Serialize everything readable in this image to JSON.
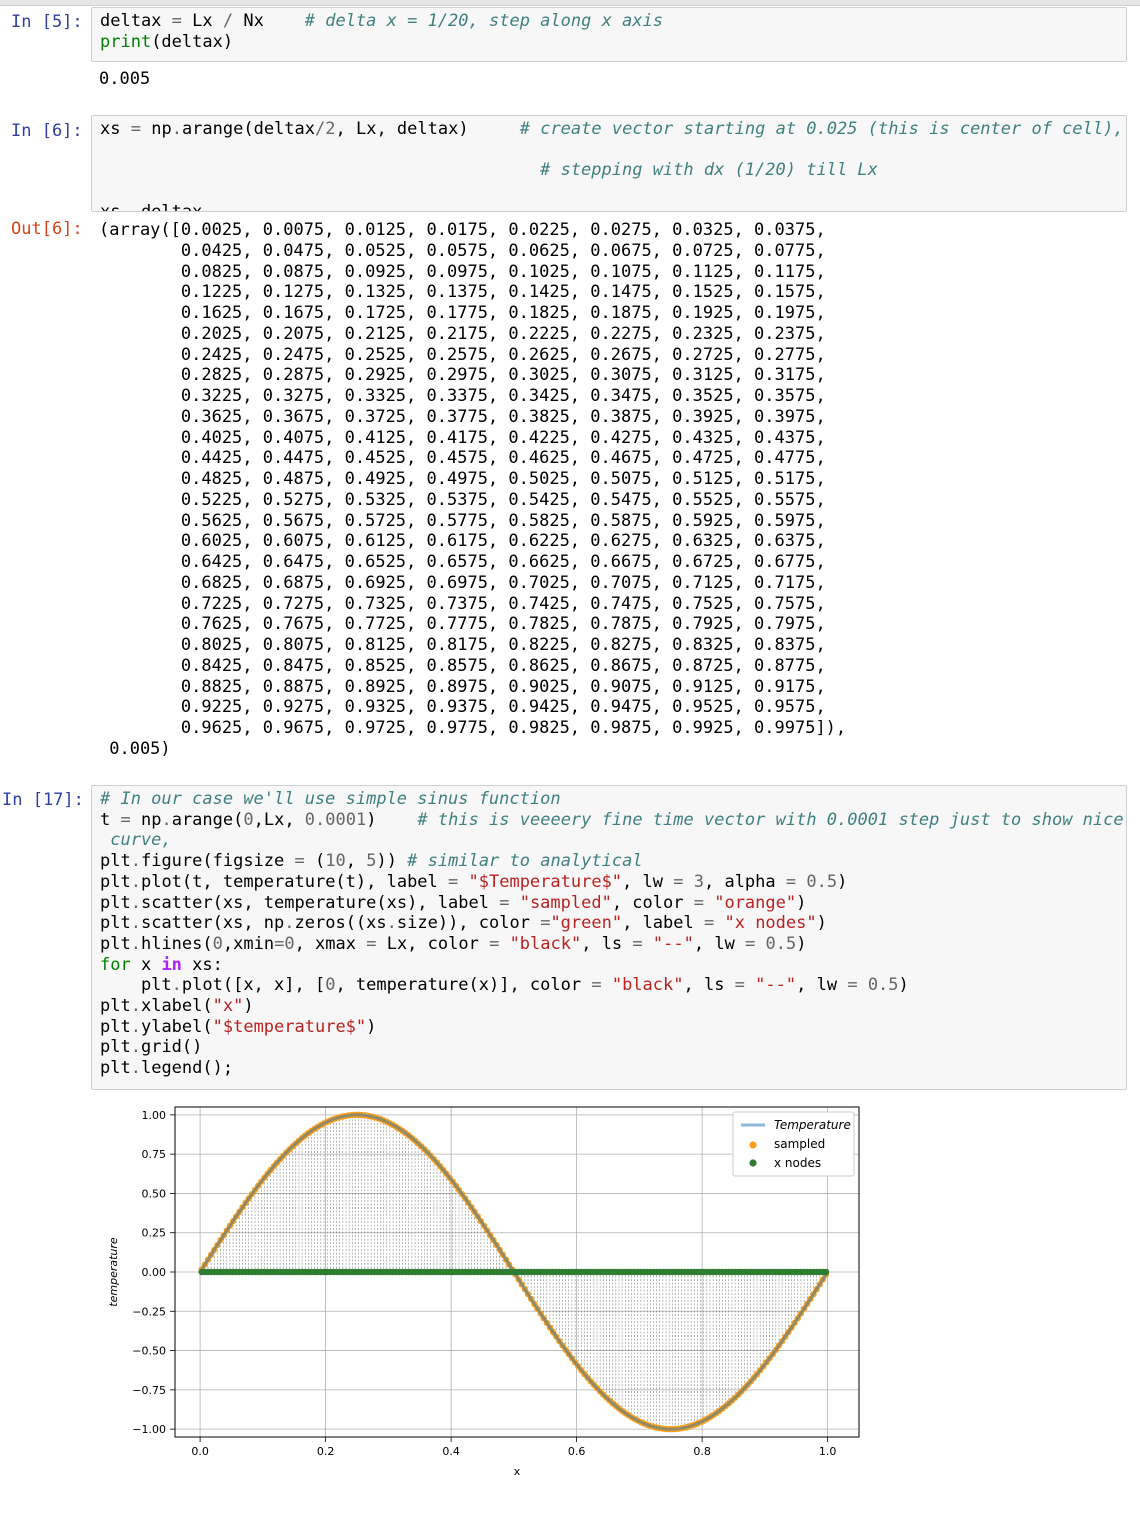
{
  "cells": [
    {
      "prompt": "In [5]:",
      "lines": [
        [
          {
            "t": "deltax "
          },
          {
            "t": "=",
            "c": "op"
          },
          {
            "t": " Lx "
          },
          {
            "t": "/",
            "c": "op"
          },
          {
            "t": " Nx    "
          },
          {
            "t": "# delta x = 1/20, step along x axis",
            "c": "cm"
          }
        ],
        [
          {
            "t": "print",
            "c": "kw"
          },
          {
            "t": "(deltax)"
          }
        ]
      ],
      "output": "0.005"
    },
    {
      "prompt": "In [6]:",
      "lines": [
        [
          {
            "t": "xs "
          },
          {
            "t": "=",
            "c": "op"
          },
          {
            "t": " np"
          },
          {
            "t": ".",
            "c": "op"
          },
          {
            "t": "arange(deltax"
          },
          {
            "t": "/",
            "c": "op"
          },
          {
            "t": "2",
            "c": "nm"
          },
          {
            "t": ", Lx, deltax)     "
          },
          {
            "t": "# create vector starting at 0.025 (this is center of cell),",
            "c": "cm"
          }
        ],
        [
          {
            "t": ""
          }
        ],
        [
          {
            "t": "                                           "
          },
          {
            "t": "# stepping with dx (1/20) till Lx",
            "c": "cm"
          }
        ],
        [
          {
            "t": ""
          }
        ],
        [
          {
            "t": "xs, deltax"
          }
        ]
      ],
      "out_prompt": "Out[6]:",
      "output": "(array([0.0025, 0.0075, 0.0125, 0.0175, 0.0225, 0.0275, 0.0325, 0.0375,\n        0.0425, 0.0475, 0.0525, 0.0575, 0.0625, 0.0675, 0.0725, 0.0775,\n        0.0825, 0.0875, 0.0925, 0.0975, 0.1025, 0.1075, 0.1125, 0.1175,\n        0.1225, 0.1275, 0.1325, 0.1375, 0.1425, 0.1475, 0.1525, 0.1575,\n        0.1625, 0.1675, 0.1725, 0.1775, 0.1825, 0.1875, 0.1925, 0.1975,\n        0.2025, 0.2075, 0.2125, 0.2175, 0.2225, 0.2275, 0.2325, 0.2375,\n        0.2425, 0.2475, 0.2525, 0.2575, 0.2625, 0.2675, 0.2725, 0.2775,\n        0.2825, 0.2875, 0.2925, 0.2975, 0.3025, 0.3075, 0.3125, 0.3175,\n        0.3225, 0.3275, 0.3325, 0.3375, 0.3425, 0.3475, 0.3525, 0.3575,\n        0.3625, 0.3675, 0.3725, 0.3775, 0.3825, 0.3875, 0.3925, 0.3975,\n        0.4025, 0.4075, 0.4125, 0.4175, 0.4225, 0.4275, 0.4325, 0.4375,\n        0.4425, 0.4475, 0.4525, 0.4575, 0.4625, 0.4675, 0.4725, 0.4775,\n        0.4825, 0.4875, 0.4925, 0.4975, 0.5025, 0.5075, 0.5125, 0.5175,\n        0.5225, 0.5275, 0.5325, 0.5375, 0.5425, 0.5475, 0.5525, 0.5575,\n        0.5625, 0.5675, 0.5725, 0.5775, 0.5825, 0.5875, 0.5925, 0.5975,\n        0.6025, 0.6075, 0.6125, 0.6175, 0.6225, 0.6275, 0.6325, 0.6375,\n        0.6425, 0.6475, 0.6525, 0.6575, 0.6625, 0.6675, 0.6725, 0.6775,\n        0.6825, 0.6875, 0.6925, 0.6975, 0.7025, 0.7075, 0.7125, 0.7175,\n        0.7225, 0.7275, 0.7325, 0.7375, 0.7425, 0.7475, 0.7525, 0.7575,\n        0.7625, 0.7675, 0.7725, 0.7775, 0.7825, 0.7875, 0.7925, 0.7975,\n        0.8025, 0.8075, 0.8125, 0.8175, 0.8225, 0.8275, 0.8325, 0.8375,\n        0.8425, 0.8475, 0.8525, 0.8575, 0.8625, 0.8675, 0.8725, 0.8775,\n        0.8825, 0.8875, 0.8925, 0.8975, 0.9025, 0.9075, 0.9125, 0.9175,\n        0.9225, 0.9275, 0.9325, 0.9375, 0.9425, 0.9475, 0.9525, 0.9575,\n        0.9625, 0.9675, 0.9725, 0.9775, 0.9825, 0.9875, 0.9925, 0.9975]),\n 0.005)"
    },
    {
      "prompt": "In [17]:",
      "lines": [
        [
          {
            "t": "# In our case we'll use simple sinus function",
            "c": "cm"
          }
        ],
        [
          {
            "t": "t "
          },
          {
            "t": "=",
            "c": "op"
          },
          {
            "t": " np"
          },
          {
            "t": ".",
            "c": "op"
          },
          {
            "t": "arange("
          },
          {
            "t": "0",
            "c": "nm"
          },
          {
            "t": ",Lx, "
          },
          {
            "t": "0.0001",
            "c": "nm"
          },
          {
            "t": ")    "
          },
          {
            "t": "# this is veeeery fine time vector with 0.0001 step just to show nice",
            "c": "cm"
          }
        ],
        [
          {
            "t": " curve,",
            "c": "cm"
          }
        ],
        [
          {
            "t": "plt"
          },
          {
            "t": ".",
            "c": "op"
          },
          {
            "t": "figure(figsize "
          },
          {
            "t": "=",
            "c": "op"
          },
          {
            "t": " ("
          },
          {
            "t": "10",
            "c": "nm"
          },
          {
            "t": ", "
          },
          {
            "t": "5",
            "c": "nm"
          },
          {
            "t": ")) "
          },
          {
            "t": "# similar to analytical",
            "c": "cm"
          }
        ],
        [
          {
            "t": "plt"
          },
          {
            "t": ".",
            "c": "op"
          },
          {
            "t": "plot(t, temperature(t), label "
          },
          {
            "t": "=",
            "c": "op"
          },
          {
            "t": " "
          },
          {
            "t": "\"$Temperature$\"",
            "c": "st"
          },
          {
            "t": ", lw "
          },
          {
            "t": "=",
            "c": "op"
          },
          {
            "t": " "
          },
          {
            "t": "3",
            "c": "nm"
          },
          {
            "t": ", alpha "
          },
          {
            "t": "=",
            "c": "op"
          },
          {
            "t": " "
          },
          {
            "t": "0.5",
            "c": "nm"
          },
          {
            "t": ")"
          }
        ],
        [
          {
            "t": "plt"
          },
          {
            "t": ".",
            "c": "op"
          },
          {
            "t": "scatter(xs, temperature(xs), label "
          },
          {
            "t": "=",
            "c": "op"
          },
          {
            "t": " "
          },
          {
            "t": "\"sampled\"",
            "c": "st"
          },
          {
            "t": ", color "
          },
          {
            "t": "=",
            "c": "op"
          },
          {
            "t": " "
          },
          {
            "t": "\"orange\"",
            "c": "st"
          },
          {
            "t": ")"
          }
        ],
        [
          {
            "t": "plt"
          },
          {
            "t": ".",
            "c": "op"
          },
          {
            "t": "scatter(xs, np"
          },
          {
            "t": ".",
            "c": "op"
          },
          {
            "t": "zeros((xs"
          },
          {
            "t": ".",
            "c": "op"
          },
          {
            "t": "size)), color "
          },
          {
            "t": "=",
            "c": "op"
          },
          {
            "t": "\"green\"",
            "c": "st"
          },
          {
            "t": ", label "
          },
          {
            "t": "=",
            "c": "op"
          },
          {
            "t": " "
          },
          {
            "t": "\"x nodes\"",
            "c": "st"
          },
          {
            "t": ")"
          }
        ],
        [
          {
            "t": "plt"
          },
          {
            "t": ".",
            "c": "op"
          },
          {
            "t": "hlines("
          },
          {
            "t": "0",
            "c": "nm"
          },
          {
            "t": ",xmin"
          },
          {
            "t": "=",
            "c": "op"
          },
          {
            "t": "0",
            "c": "nm"
          },
          {
            "t": ", xmax "
          },
          {
            "t": "=",
            "c": "op"
          },
          {
            "t": " Lx, color "
          },
          {
            "t": "=",
            "c": "op"
          },
          {
            "t": " "
          },
          {
            "t": "\"black\"",
            "c": "st"
          },
          {
            "t": ", ls "
          },
          {
            "t": "=",
            "c": "op"
          },
          {
            "t": " "
          },
          {
            "t": "\"--\"",
            "c": "st"
          },
          {
            "t": ", lw "
          },
          {
            "t": "=",
            "c": "op"
          },
          {
            "t": " "
          },
          {
            "t": "0.5",
            "c": "nm"
          },
          {
            "t": ")"
          }
        ],
        [
          {
            "t": "for",
            "c": "kw"
          },
          {
            "t": " x "
          },
          {
            "t": "in",
            "c": "kw2"
          },
          {
            "t": " xs:"
          }
        ],
        [
          {
            "t": "    plt"
          },
          {
            "t": ".",
            "c": "op"
          },
          {
            "t": "plot([x, x], ["
          },
          {
            "t": "0",
            "c": "nm"
          },
          {
            "t": ", temperature(x)], color "
          },
          {
            "t": "=",
            "c": "op"
          },
          {
            "t": " "
          },
          {
            "t": "\"black\"",
            "c": "st"
          },
          {
            "t": ", ls "
          },
          {
            "t": "=",
            "c": "op"
          },
          {
            "t": " "
          },
          {
            "t": "\"--\"",
            "c": "st"
          },
          {
            "t": ", lw "
          },
          {
            "t": "=",
            "c": "op"
          },
          {
            "t": " "
          },
          {
            "t": "0.5",
            "c": "nm"
          },
          {
            "t": ")"
          }
        ],
        [
          {
            "t": "plt"
          },
          {
            "t": ".",
            "c": "op"
          },
          {
            "t": "xlabel("
          },
          {
            "t": "\"x\"",
            "c": "st"
          },
          {
            "t": ")"
          }
        ],
        [
          {
            "t": "plt"
          },
          {
            "t": ".",
            "c": "op"
          },
          {
            "t": "ylabel("
          },
          {
            "t": "\"$temperature$\"",
            "c": "st"
          },
          {
            "t": ")"
          }
        ],
        [
          {
            "t": "plt"
          },
          {
            "t": ".",
            "c": "op"
          },
          {
            "t": "grid()"
          }
        ],
        [
          {
            "t": "plt"
          },
          {
            "t": ".",
            "c": "op"
          },
          {
            "t": "legend();"
          }
        ]
      ]
    }
  ],
  "colors": {
    "in_prompt": "#303f9f",
    "out_prompt": "#d84315",
    "curve": "#1f77b4",
    "sampled": "#ff9f1c",
    "nodes": "#2e7d32"
  },
  "chart_data": {
    "type": "line",
    "function": "sin(2*pi*x)",
    "curve": {
      "name": "Temperature",
      "x_range": [
        0,
        1
      ]
    },
    "scatter_series": [
      {
        "name": "sampled",
        "x_start": 0.0025,
        "x_step": 0.005,
        "x_end": 0.9975,
        "y": "sin(2*pi*x)"
      },
      {
        "name": "x nodes",
        "x_start": 0.0025,
        "x_step": 0.005,
        "x_end": 0.9975,
        "y": 0
      }
    ],
    "xlabel": "x",
    "ylabel": "temperature",
    "xlim": [
      -0.04,
      1.05
    ],
    "ylim": [
      -1.05,
      1.05
    ],
    "xticks": [
      "0.0",
      "0.2",
      "0.4",
      "0.6",
      "0.8",
      "1.0"
    ],
    "yticks": [
      "1.00",
      "0.75",
      "0.50",
      "0.25",
      "0.00",
      "−0.25",
      "−0.50",
      "−0.75",
      "−1.00"
    ],
    "grid": true,
    "legend": [
      "Temperature",
      "sampled",
      "x nodes"
    ],
    "legend_position": "top-right"
  }
}
